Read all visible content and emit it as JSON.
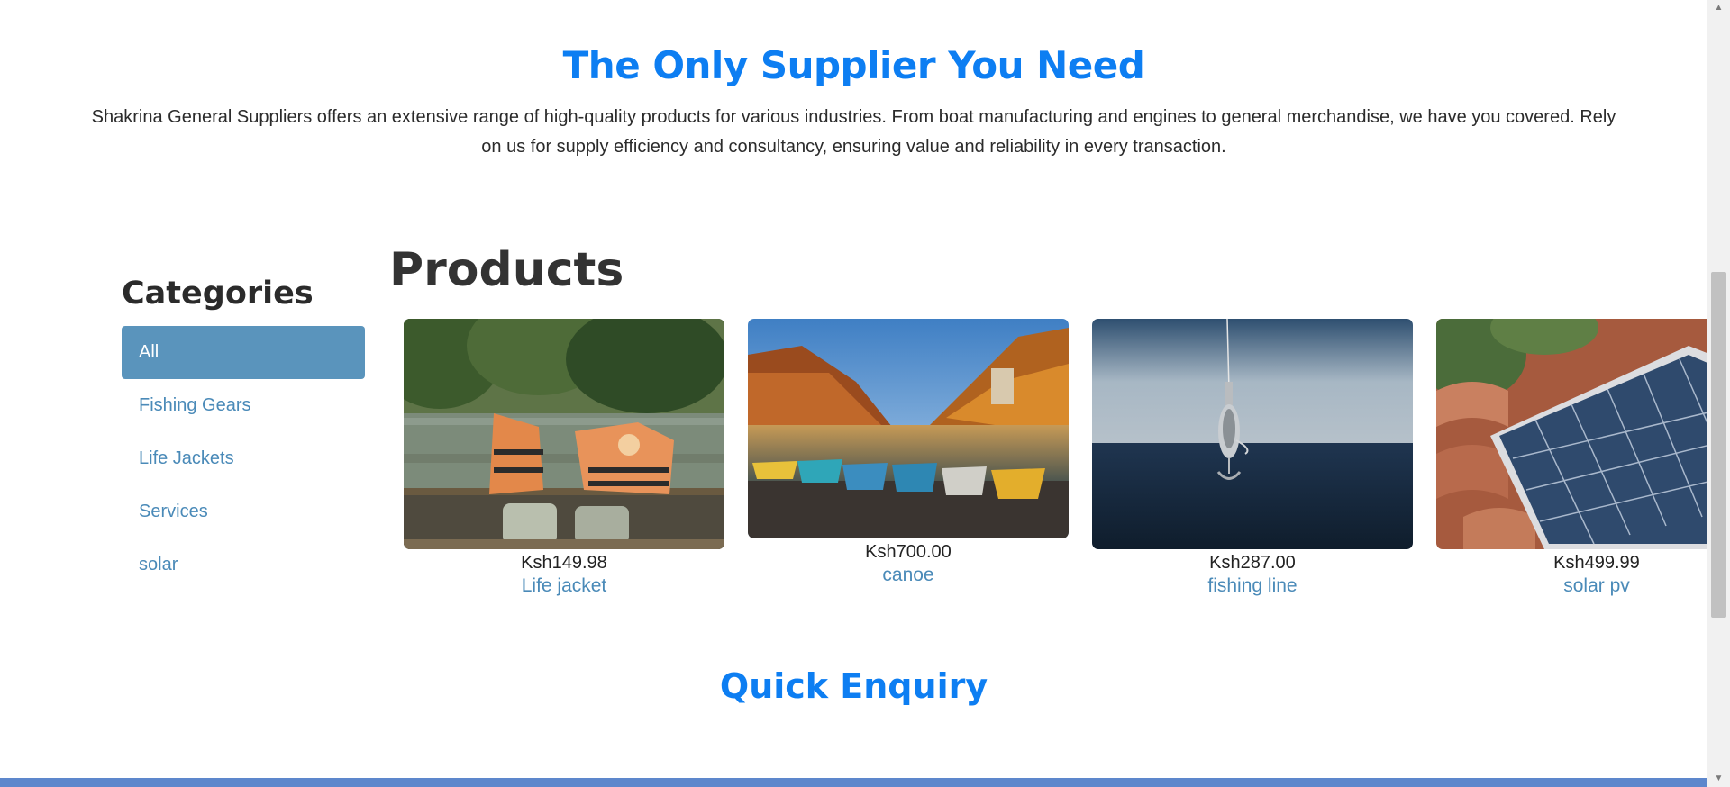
{
  "hero": {
    "title": "The Only Supplier You Need",
    "text": "Shakrina General Suppliers offers an extensive range of high-quality products for various industries. From boat manufacturing and engines to general merchandise, we have you covered. Rely on us for supply efficiency and consultancy, ensuring value and reliability in every transaction."
  },
  "categories": {
    "heading": "Categories",
    "items": [
      {
        "label": "All",
        "active": true
      },
      {
        "label": "Fishing Gears"
      },
      {
        "label": "Life Jackets"
      },
      {
        "label": "Services"
      },
      {
        "label": "solar"
      }
    ]
  },
  "products": {
    "heading": "Products",
    "items": [
      {
        "price": "Ksh149.98",
        "name": "Life jacket",
        "image": "life-jackets-photo"
      },
      {
        "price": "Ksh700.00",
        "name": "canoe",
        "image": "canoes-lake-photo"
      },
      {
        "price": "Ksh287.00",
        "name": "fishing line",
        "image": "fishing-lure-photo"
      },
      {
        "price": "Ksh499.99",
        "name": "solar pv",
        "image": "solar-panel-photo"
      }
    ]
  },
  "enquiry": {
    "heading": "Quick Enquiry"
  },
  "colors": {
    "accent": "#0d7ef2",
    "link": "#4a8ab8",
    "active_category": "#5a94bc",
    "footer_bar": "#5d87cc"
  }
}
